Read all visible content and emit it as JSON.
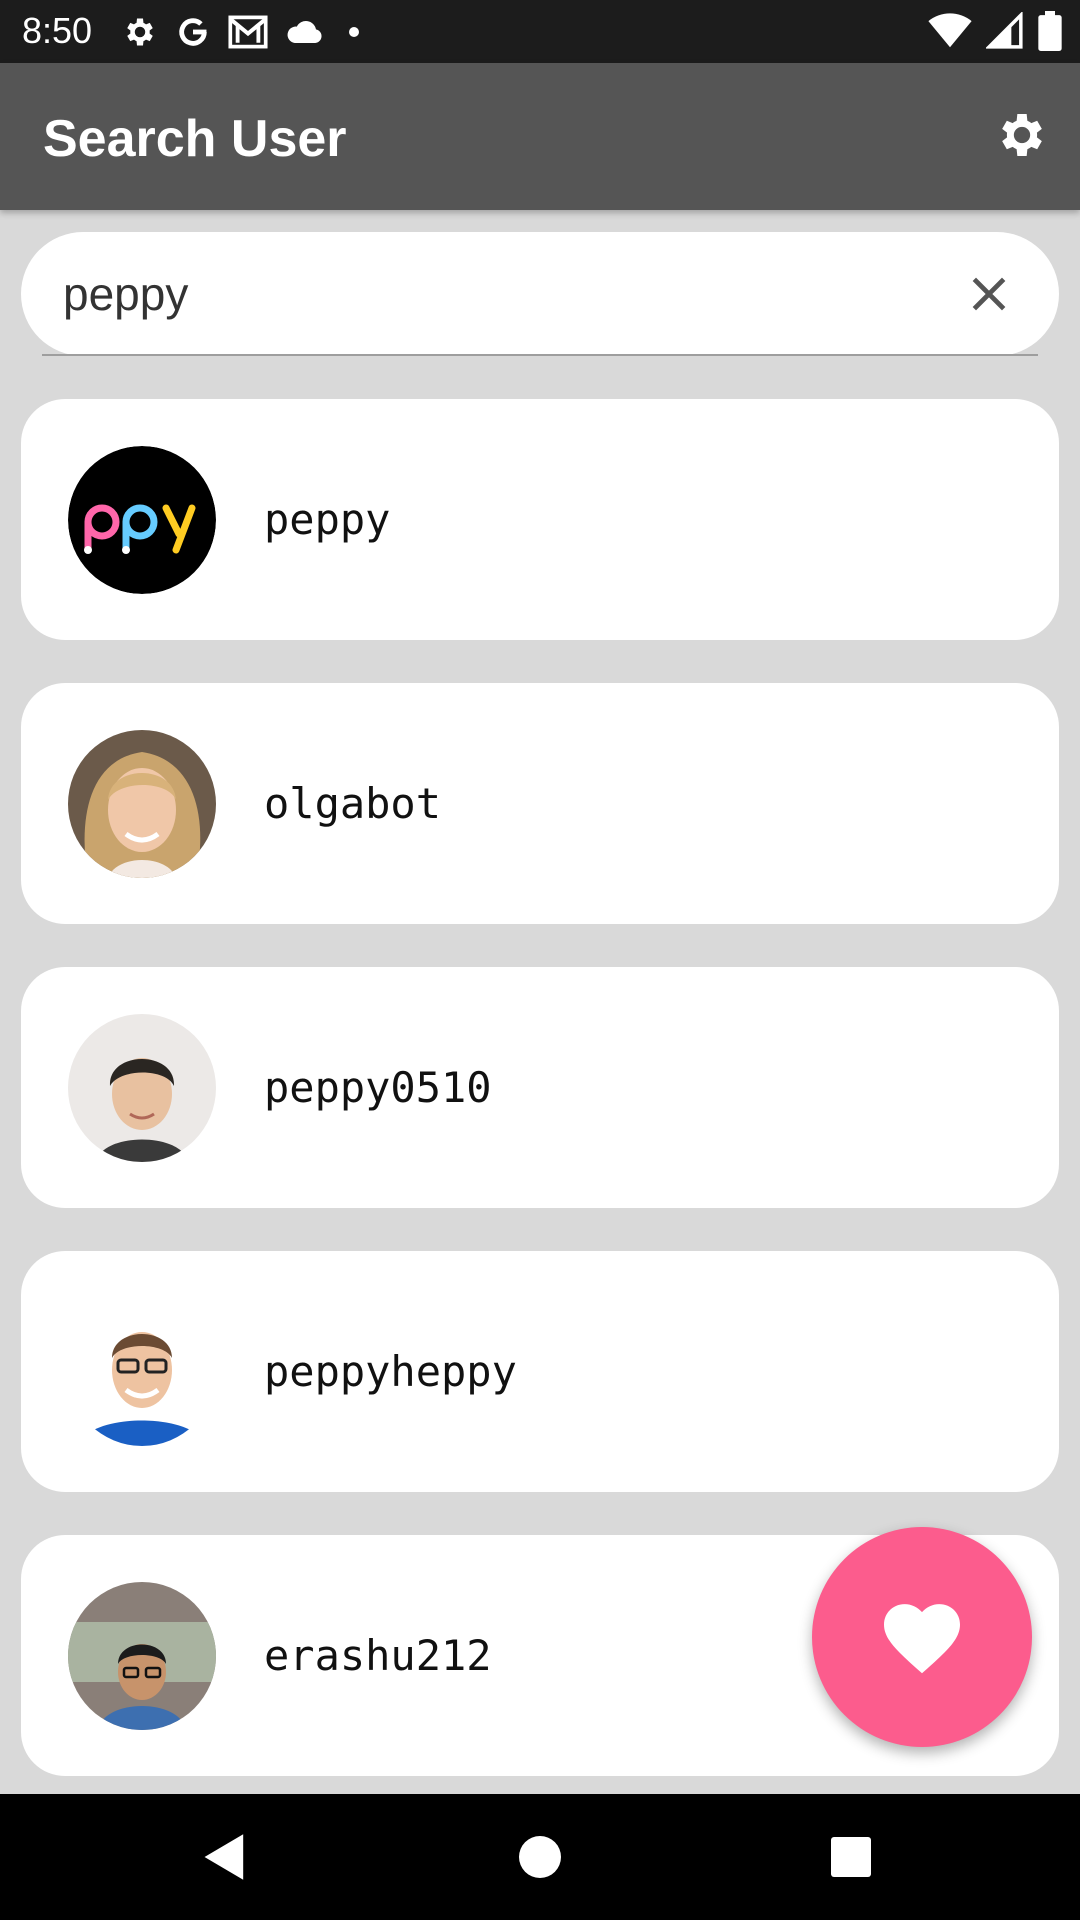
{
  "status_bar": {
    "time": "8:50",
    "left_icons": [
      "settings-icon",
      "google-icon",
      "gmail-icon",
      "cloud-icon",
      "dot-icon"
    ],
    "right_icons": [
      "wifi-icon",
      "signal-icon",
      "battery-icon"
    ]
  },
  "app_bar": {
    "title": "Search User",
    "action_icon": "settings-icon"
  },
  "search": {
    "value": "peppy",
    "clear_icon": "close-icon",
    "caret_color": "#ff5c8d"
  },
  "users": [
    {
      "username": "peppy",
      "avatar": "ppy-logo"
    },
    {
      "username": "olgabot",
      "avatar": "photo"
    },
    {
      "username": "peppy0510",
      "avatar": "photo"
    },
    {
      "username": "peppyheppy",
      "avatar": "photo"
    },
    {
      "username": "erashu212",
      "avatar": "photo"
    }
  ],
  "fab": {
    "icon": "heart-icon",
    "color": "#fc5c8d"
  },
  "nav_bar": {
    "buttons": [
      "back-icon",
      "home-icon",
      "recents-icon"
    ]
  },
  "colors": {
    "app_bar": "#555555",
    "background": "#d9d9d9",
    "accent": "#fc5c8d"
  }
}
